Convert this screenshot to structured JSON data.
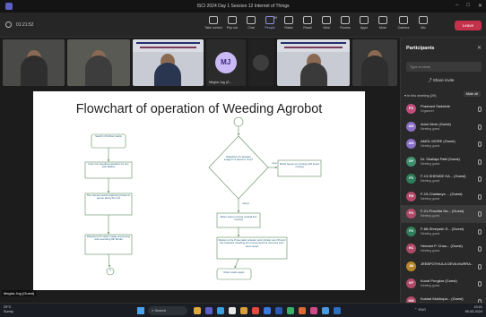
{
  "window": {
    "title": "ISCI 2024 Day 1 Session 12 Internet of Things",
    "controls": [
      "–",
      "□",
      "✕"
    ]
  },
  "meeting": {
    "timer": "01:21:52"
  },
  "toolbar": {
    "items": [
      {
        "label": "Take control",
        "icon": "take-control-icon"
      },
      {
        "label": "Pop out",
        "icon": "pop-out-icon"
      },
      {
        "label": "Chat",
        "icon": "chat-icon"
      },
      {
        "label": "People",
        "icon": "people-icon",
        "badge": "29"
      },
      {
        "label": "Raise",
        "icon": "raise-hand-icon"
      },
      {
        "label": "React",
        "icon": "react-icon"
      },
      {
        "label": "View",
        "icon": "view-icon"
      },
      {
        "label": "Rooms",
        "icon": "rooms-icon"
      },
      {
        "label": "Apps",
        "icon": "apps-icon"
      },
      {
        "label": "More",
        "icon": "more-icon"
      },
      {
        "label": "Camera",
        "icon": "camera-icon"
      },
      {
        "label": "Mic",
        "icon": "mic-icon"
      },
      {
        "label": "Share",
        "icon": "share-icon"
      }
    ],
    "leave_label": "Leave"
  },
  "video_strip": {
    "avatar_initials": "MJ",
    "avatar_caption": "Megha Jog (G..."
  },
  "slide": {
    "title": "Flowchart of operation of Weeding Agrobot",
    "left_boxes": [
      "Switch ON Motor starts",
      "Inter-row weeding operation by two side blades",
      "The camera starts capturing photos in queue along the row",
      "Raspberry Pi starts image processing and executing ML Model"
    ],
    "connector_a": "A",
    "decision": "Raspberry Pi decides image is a weed or crop?",
    "decision_yes": "crop",
    "decision_no": "weed",
    "crop_box": "Motor keeps on running with linear moving",
    "weed_box": "Motor stops running vertical line running",
    "relay_box": "Relays to the Pneumatic actuator and cylinder are ON and the rotavator weeding tool comes down & removes from stem weed",
    "end_box": "Motor starts again"
  },
  "presenter_label": "Megha Jog (Guest)",
  "participants": {
    "title": "Participants",
    "search_placeholder": "Type a name",
    "share_invite": "Share invite",
    "section_label": "In this meeting (29)",
    "mute_all": "Mute all",
    "list": [
      {
        "initials": "PS",
        "name": "Prashant Sadafule",
        "role": "Organizer",
        "color": "#c04d7a"
      },
      {
        "initials": "AM",
        "name": "Amol More (Guest)",
        "role": "Meeting guest",
        "color": "#8a6fc7"
      },
      {
        "initials": "AM",
        "name": "AMOL MORE (Guest)",
        "role": "Meeting guest",
        "color": "#8a6fc7"
      },
      {
        "initials": "DP",
        "name": "Dr. Shailaja Patil (Guest)",
        "role": "Meeting guest",
        "color": "#3f8f6f"
      },
      {
        "initials": "FS",
        "name": "F-13-SHENDE KA... (Guest)",
        "role": "Meeting guest",
        "color": "#2f7d5a"
      },
      {
        "initials": "FM",
        "name": "F-19-Chaitanya ... (Guest)",
        "role": "Meeting guest",
        "color": "#b04a6a"
      },
      {
        "initials": "FN",
        "name": "F-21-Prachita Na... (Guest)",
        "role": "Meeting guest",
        "color": "#b04a6a"
      },
      {
        "initials": "FS",
        "name": "F-68-Shreyash S... (Guest)",
        "role": "Meeting guest",
        "color": "#2f7d5a"
      },
      {
        "initials": "HC",
        "name": "Hemant P. Chau... (Guest)",
        "role": "Meeting guest",
        "color": "#b04a6a"
      },
      {
        "initials": "JM",
        "name": "JEEBPOTHULA DEVA MURRA...",
        "role": "",
        "color": "#b8862a"
      },
      {
        "initials": "KP",
        "name": "Kunal Pungkar (Guest)",
        "role": "Meeting guest",
        "color": "#b04a6a"
      },
      {
        "initials": "KM",
        "name": "Kushal Mukhopa... (Guest)",
        "role": "Meeting guest",
        "color": "#b04a6a"
      }
    ]
  },
  "taskbar": {
    "temperature": "29°C",
    "weather": "Sunny",
    "search_label": "Search",
    "language": "ENG",
    "language_region": "IN",
    "time": "10:21",
    "date": "05-03-2024",
    "icon_colors": [
      "#e0a93a",
      "#5b5fc7",
      "#3aa0e0",
      "#e8e8e8",
      "#d9a03a",
      "#e04a3a",
      "#3a7ae0",
      "#2a5ab0",
      "#3ab06a",
      "#e06a3a",
      "#d04a8a",
      "#4a9ae0",
      "#2f6fc0"
    ]
  }
}
